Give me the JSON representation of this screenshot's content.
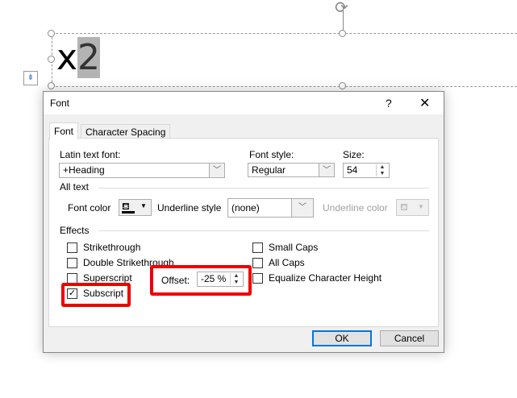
{
  "slide": {
    "text_base": "x",
    "text_sub": "2"
  },
  "dialog": {
    "title": "Font",
    "help_label": "?",
    "close_label": "✕",
    "tabs": [
      {
        "label": "Font",
        "active": true
      },
      {
        "label": "Character Spacing",
        "active": false
      }
    ],
    "latin_font": {
      "label": "Latin text font:",
      "value": "+Heading"
    },
    "font_style": {
      "label": "Font style:",
      "value": "Regular"
    },
    "size": {
      "label": "Size:",
      "value": "54"
    },
    "all_text": {
      "heading": "All text",
      "font_color_label": "Font color",
      "underline_style_label": "Underline style",
      "underline_style_value": "(none)",
      "underline_color_label": "Underline color"
    },
    "effects": {
      "heading": "Effects",
      "left": [
        {
          "label": "Strikethrough",
          "checked": false
        },
        {
          "label": "Double Strikethrough",
          "checked": false
        },
        {
          "label": "Superscript",
          "checked": false
        },
        {
          "label": "Subscript",
          "checked": true
        }
      ],
      "right": [
        {
          "label": "Small Caps",
          "checked": false
        },
        {
          "label": "All Caps",
          "checked": false
        },
        {
          "label": "Equalize Character Height",
          "checked": false
        }
      ],
      "offset_label": "Offset:",
      "offset_value": "-25 %"
    },
    "ok_label": "OK",
    "cancel_label": "Cancel"
  },
  "colors": {
    "highlight": "#e00000",
    "ok_border": "#0078d7"
  }
}
